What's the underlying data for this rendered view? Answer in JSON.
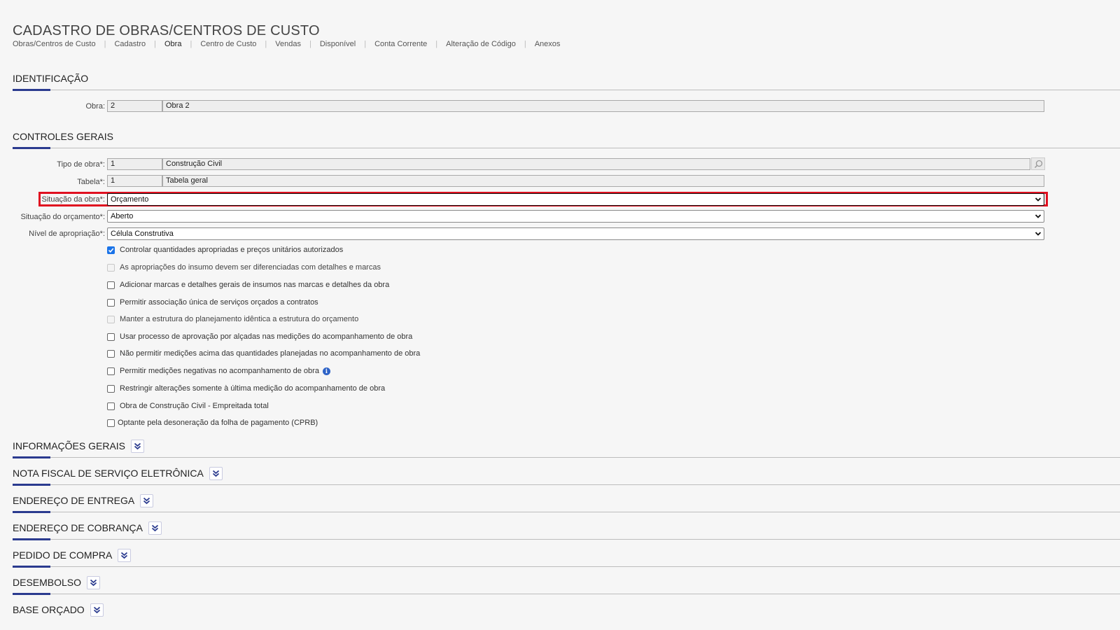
{
  "page_title": "CADASTRO DE OBRAS/CENTROS DE CUSTO",
  "breadcrumb": [
    "Obras/Centros de Custo",
    "Cadastro",
    "Obra",
    "Centro de Custo",
    "Vendas",
    "Disponível",
    "Conta Corrente",
    "Alteração de Código",
    "Anexos"
  ],
  "identificacao": {
    "title": "IDENTIFICAÇÃO",
    "obra_label": "Obra:",
    "obra_code": "2",
    "obra_name": "Obra 2"
  },
  "controles": {
    "title": "CONTROLES GERAIS",
    "tipo_label": "Tipo de obra*:",
    "tipo_code": "1",
    "tipo_name": "Construção Civil",
    "tabela_label": "Tabela*:",
    "tabela_code": "1",
    "tabela_name": "Tabela geral",
    "situacao_obra_label": "Situação da obra*:",
    "situacao_obra_value": "Orçamento",
    "situacao_orc_label": "Situação do orçamento*:",
    "situacao_orc_value": "Aberto",
    "nivel_label": "Nível de apropriação*:",
    "nivel_value": "Célula Construtiva",
    "checkboxes": [
      {
        "label": "Controlar quantidades apropriadas e preços unitários autorizados",
        "checked": true,
        "disabled": false
      },
      {
        "label": "As apropriações do insumo devem ser diferenciadas com detalhes e marcas",
        "checked": false,
        "disabled": true
      },
      {
        "label": "Adicionar marcas e detalhes gerais de insumos nas marcas e detalhes da obra",
        "checked": false,
        "disabled": false
      },
      {
        "label": "Permitir associação única de serviços orçados a contratos",
        "checked": false,
        "disabled": false
      },
      {
        "label": "Manter a estrutura do planejamento idêntica a estrutura do orçamento",
        "checked": false,
        "disabled": true
      },
      {
        "label": "Usar processo de aprovação por alçadas nas medições do acompanhamento de obra",
        "checked": false,
        "disabled": false
      },
      {
        "label": "Não permitir medições acima das quantidades planejadas no acompanhamento de obra",
        "checked": false,
        "disabled": false
      },
      {
        "label": "Permitir medições negativas no acompanhamento de obra",
        "checked": false,
        "disabled": false,
        "info": true
      },
      {
        "label": "Restringir alterações somente à última medição do acompanhamento de obra",
        "checked": false,
        "disabled": false
      },
      {
        "label": "Obra de Construção Civil - Empreitada total",
        "checked": false,
        "disabled": false
      },
      {
        "label": "Optante pela desoneração da folha de pagamento (CPRB)",
        "checked": false,
        "disabled": false
      }
    ]
  },
  "collapsed_sections": [
    "INFORMAÇÕES GERAIS",
    "NOTA FISCAL DE SERVIÇO ELETRÔNICA",
    "ENDEREÇO DE ENTREGA",
    "ENDEREÇO DE COBRANÇA",
    "PEDIDO DE COMPRA",
    "DESEMBOLSO",
    "BASE ORÇADO"
  ],
  "colors": {
    "accent": "#2b3b8f",
    "highlight": "#e01020",
    "checkbox": "#1a73e8"
  }
}
